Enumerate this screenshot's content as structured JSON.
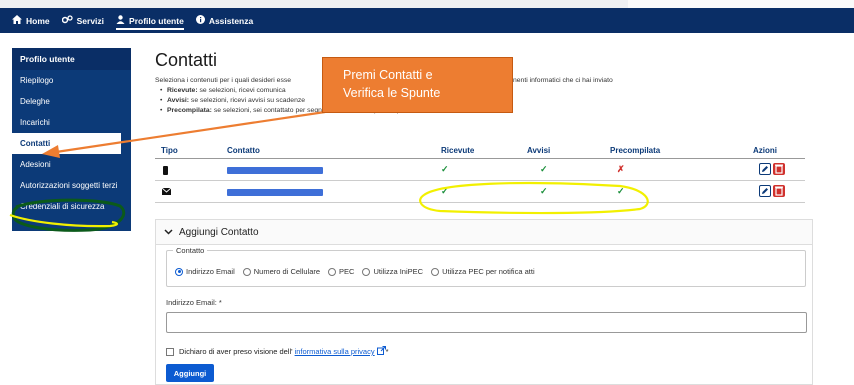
{
  "nav": {
    "items": [
      {
        "label": "Home",
        "icon": "home-icon"
      },
      {
        "label": "Servizi",
        "icon": "services-icon"
      },
      {
        "label": "Profilo utente",
        "icon": "user-icon"
      },
      {
        "label": "Assistenza",
        "icon": "info-icon"
      }
    ],
    "active": "Profilo utente"
  },
  "sidebar": {
    "title": "Profilo utente",
    "items": [
      "Riepilogo",
      "Deleghe",
      "Incarichi",
      "Contatti",
      "Adesioni",
      "Autorizzazioni soggetti terzi",
      "Credenziali di sicurezza"
    ],
    "active": "Contatti"
  },
  "main": {
    "title": "Contatti",
    "intro": "Seleziona i contenuti per i quali desideri esse",
    "intro_tail": "nenti informatici che ci hai inviato",
    "bullets": [
      {
        "label": "Ricevute:",
        "text": " se selezioni, ricevi comunica"
      },
      {
        "label": "Avvisi:",
        "text": " se selezioni, ricevi avvisi su scadenze"
      },
      {
        "label": "Precompilata:",
        "text": " se selezioni, sei contattato per segnalazioni sulla tua precompilata o altro"
      }
    ]
  },
  "table": {
    "headers": [
      "Tipo",
      "Contatto",
      "Ricevute",
      "Avvisi",
      "Precompilata",
      "Azioni"
    ],
    "rows": [
      {
        "tipo_icon": "mobile-phone-icon",
        "ricevute": "✓",
        "avvisi": "✓",
        "precompilata": "✗"
      },
      {
        "tipo_icon": "envelope-icon",
        "ricevute": "✓",
        "avvisi": "✓",
        "precompilata": "✓"
      }
    ]
  },
  "add_contact": {
    "title": "Aggiungi Contatto",
    "legend": "Contatto",
    "options": [
      "Indirizzo Email",
      "Numero di Cellulare",
      "PEC",
      "Utilizza IniPEC",
      "Utilizza PEC per notifica atti"
    ],
    "selected": "Indirizzo Email",
    "email_label": "Indirizzo Email: *",
    "email_value": "",
    "privacy_prefix": "Dichiaro di aver preso visione dell'",
    "privacy_link": "informativa sulla privacy",
    "privacy_suffix": " *",
    "button": "Aggiungi"
  },
  "callout": {
    "line1": "Premi Contatti e",
    "line2": "Verifica le Spunte"
  },
  "colors": {
    "navbar": "#0a2e66",
    "sidebar": "#0c3a78",
    "accent": "#0c5bd1",
    "callout": "#ed7d31",
    "highlight": "#f2f000",
    "check": "#1a8f3a",
    "cross": "#d0312d"
  }
}
